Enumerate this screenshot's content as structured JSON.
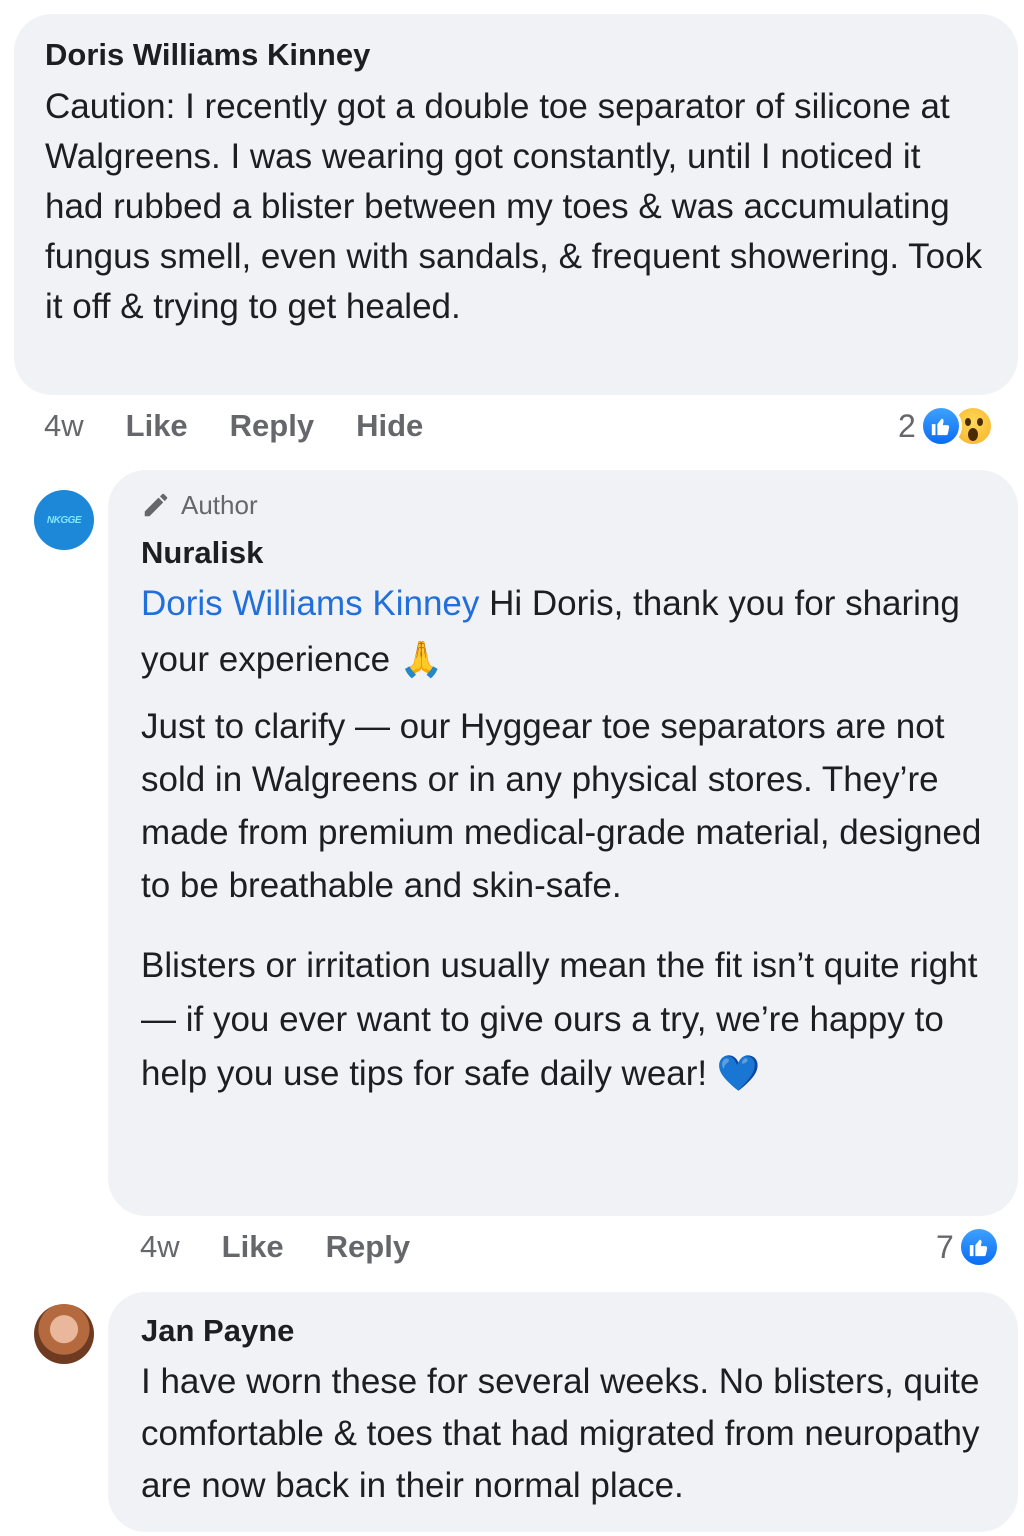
{
  "comment1": {
    "author": "Doris Williams Kinney",
    "text": "Caution: I recently got a double toe separator of silicone at Walgreens. I was wearing got constantly, until I noticed it had rubbed a blister between my toes & was accumulating fungus smell, even with sandals, & frequent showering. Took it off & trying to get healed.",
    "time": "4w",
    "actions": [
      "Like",
      "Reply",
      "Hide"
    ],
    "reaction_count": "2",
    "reactions": [
      "like-icon",
      "wow-icon"
    ]
  },
  "reply": {
    "badge": "Author",
    "badge_icon": "pencil-icon",
    "author": "Nuralisk",
    "avatar_text": "NKGGE",
    "mention": "Doris Williams Kinney",
    "para1": " Hi Doris, thank you for sharing your experience 🙏",
    "para2": "Just to clarify — our Hyggear toe separators are not sold in Walgreens or in any physical stores. They’re made from premium medical-grade material, designed to be breathable and skin-safe.",
    "para3": "Blisters or irritation usually mean the fit isn’t quite right — if you ever want to give ours a try, we’re happy to help you use tips for safe daily wear! 💙",
    "time": "4w",
    "actions": [
      "Like",
      "Reply"
    ],
    "reaction_count": "7"
  },
  "comment2": {
    "author": "Jan Payne",
    "text": "I have worn these for several weeks. No blisters, quite comfortable & toes that had migrated from neuropathy are now back in their normal place."
  },
  "colors": {
    "bubble": "#f0f2f5",
    "meta": "#65676b",
    "mention": "#216fdb",
    "like": "#1877f2"
  }
}
